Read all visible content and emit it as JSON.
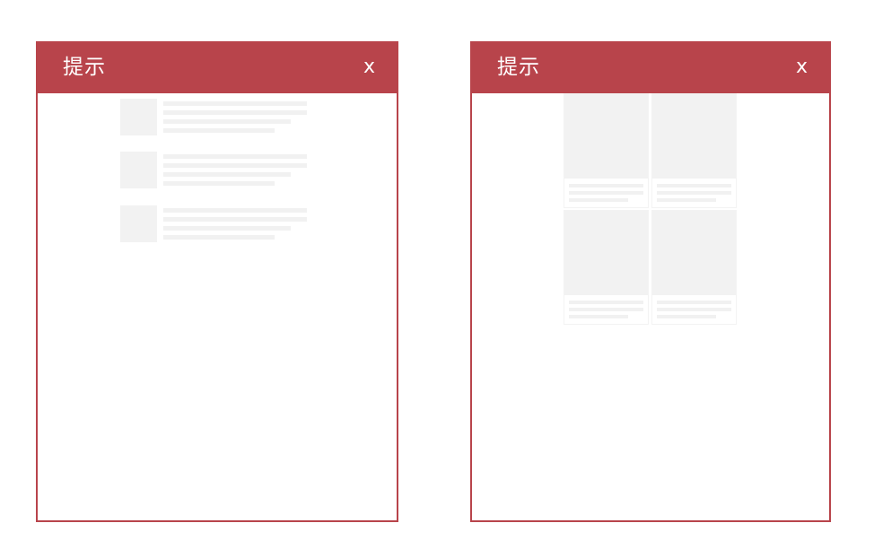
{
  "dialogs": [
    {
      "title": "提示",
      "close_label": "x",
      "placeholder_layout": "list",
      "placeholder_count": 3
    },
    {
      "title": "提示",
      "close_label": "x",
      "placeholder_layout": "grid",
      "placeholder_count": 4
    }
  ],
  "colors": {
    "accent": "#b8444b",
    "placeholder": "#f2f2f2",
    "background": "#ffffff"
  }
}
